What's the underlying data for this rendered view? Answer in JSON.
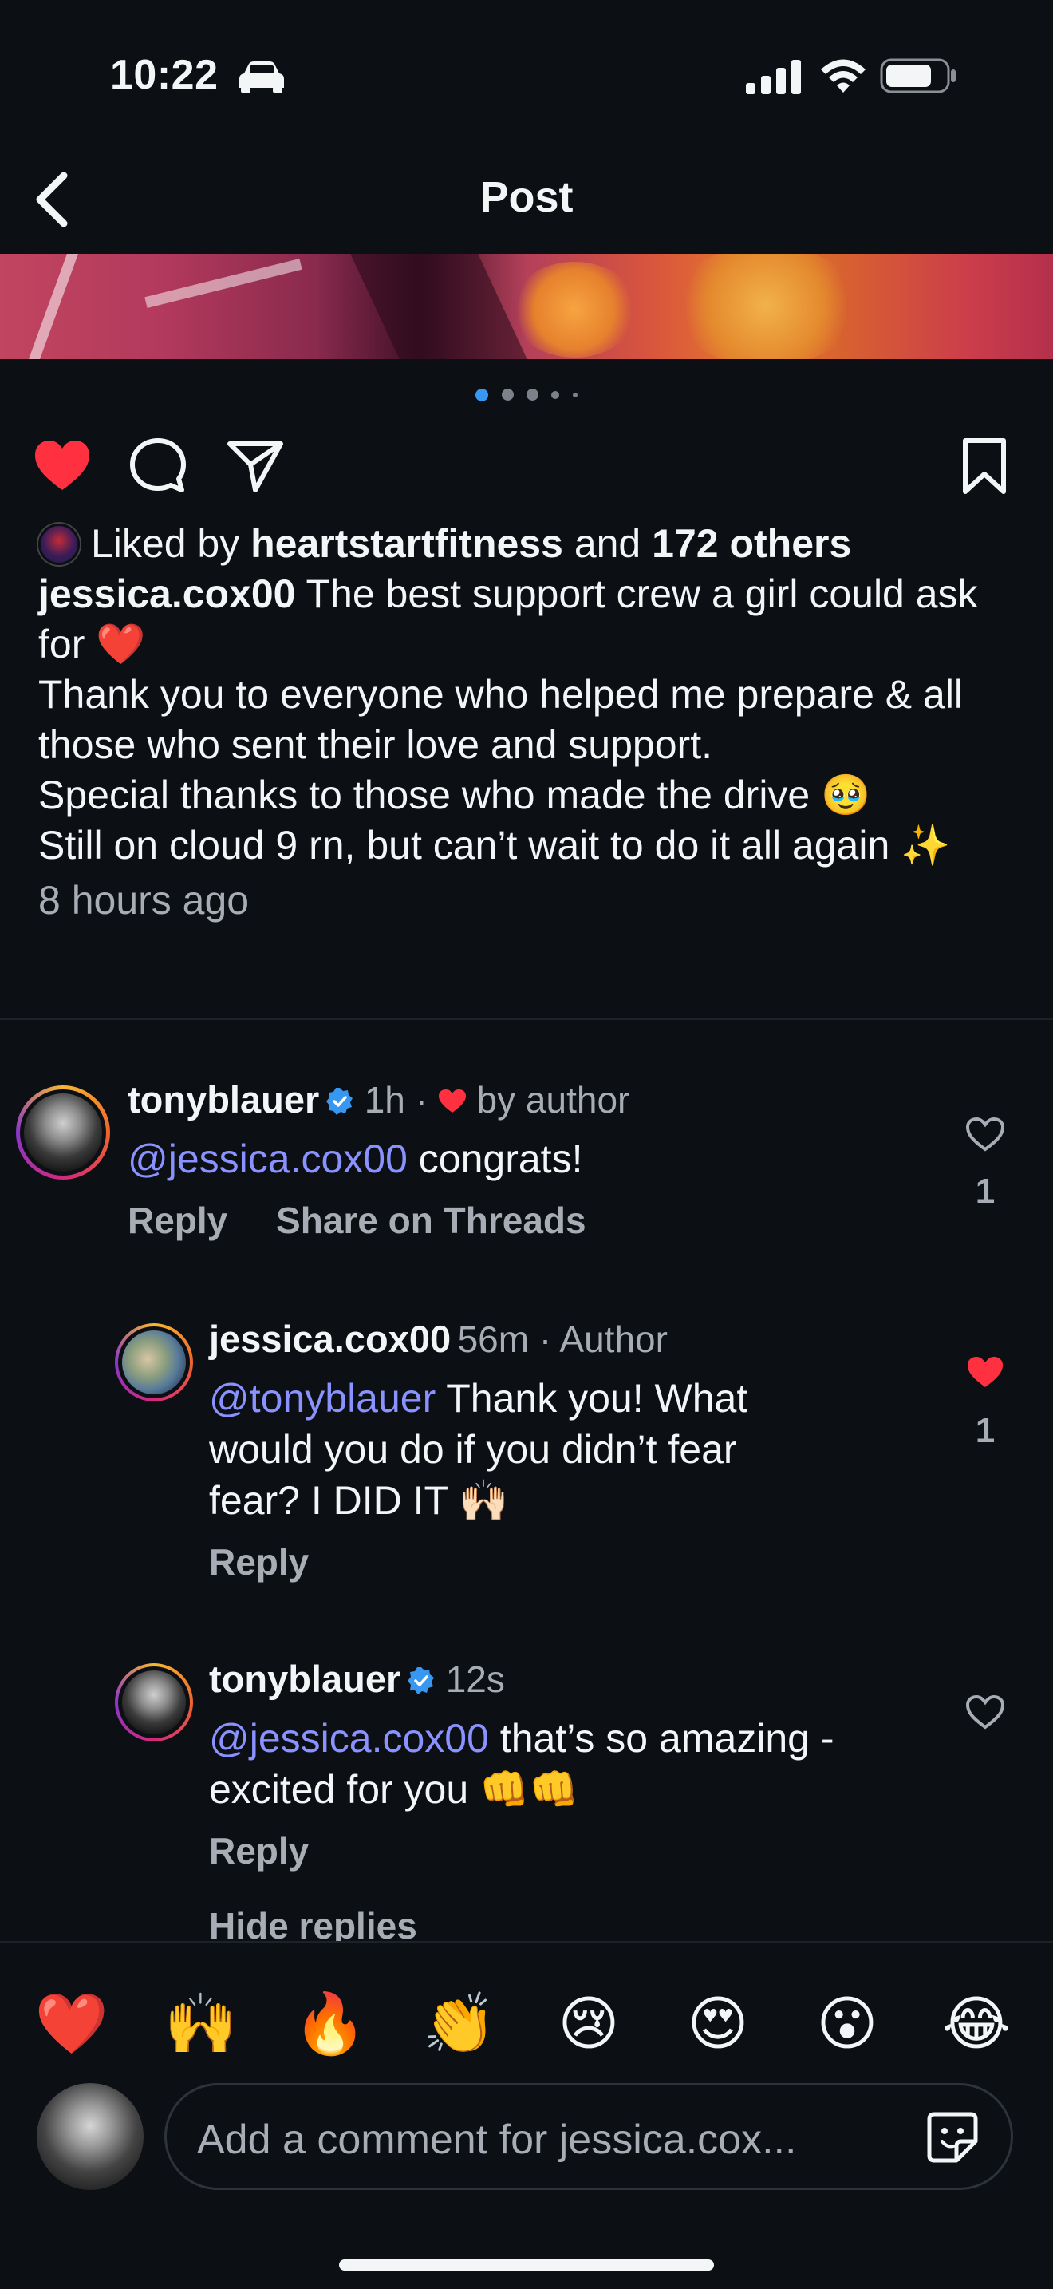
{
  "status_bar": {
    "time": "10:22"
  },
  "header": {
    "title": "Post"
  },
  "carousel": {
    "total": 5,
    "active": 1
  },
  "post": {
    "liked_by_prefix": "Liked by ",
    "liked_by_user": "heartstartfitness",
    "liked_by_and": " and ",
    "liked_by_others": "172 others",
    "author": "jessica.cox00",
    "caption_line1": " The best support crew a girl could ask for ❤️",
    "caption_line2": "Thank you to everyone who helped me prepare & all those who sent their love and support.",
    "caption_line3": "Special thanks to those who made the drive 🥹",
    "caption_line4": "Still on cloud 9 rn, but can’t wait to do it all again ✨",
    "time_ago": "8 hours ago"
  },
  "comments": [
    {
      "username": "tonyblauer",
      "verified": true,
      "time": "1h",
      "meta_suffix": " by author",
      "mention": "@jessica.cox00",
      "text": " congrats!",
      "reply_label": "Reply",
      "share_label": "Share on Threads",
      "likes": "1"
    },
    {
      "username": "jessica.cox00",
      "time": "56m",
      "meta_suffix": " · Author",
      "mention": "@tonyblauer",
      "text": " Thank you! What would you do if you didn’t fear fear? I DID IT 🙌🏻",
      "reply_label": "Reply",
      "likes": "1"
    },
    {
      "username": "tonyblauer",
      "verified": true,
      "time": "12s",
      "mention": "@jessica.cox00",
      "text": " that’s so amazing - excited for you 👊👊",
      "reply_label": "Reply",
      "hide_replies": "Hide replies"
    }
  ],
  "quick_reactions": [
    "❤️",
    "🙌",
    "🔥",
    "👏",
    "😢",
    "😍",
    "😮",
    "😂"
  ],
  "composer": {
    "placeholder": "Add a comment for jessica.cox..."
  },
  "colors": {
    "background": "#0c0f14",
    "like_red": "#ff3040",
    "mention_blue": "#8a92ff",
    "verified_blue": "#3897f0"
  }
}
